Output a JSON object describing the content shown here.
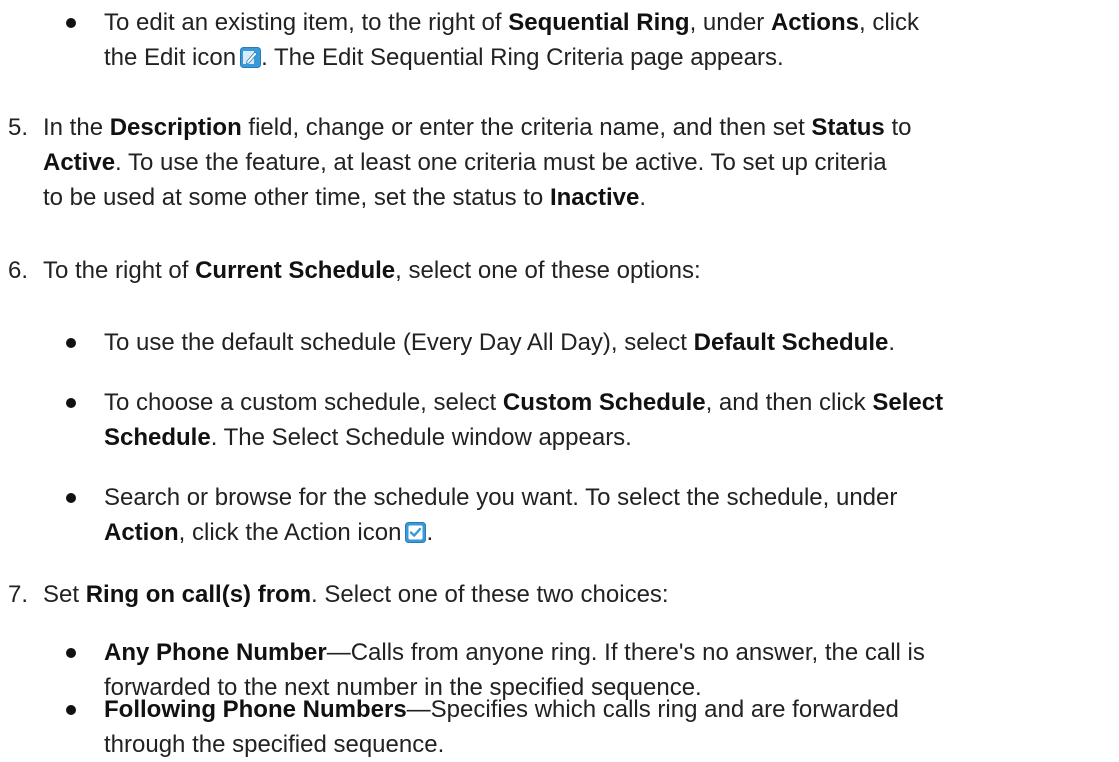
{
  "bullet_edit": {
    "t1": "To edit an existing item, to the right of ",
    "b1": "Sequential Ring",
    "t2": ", under ",
    "b2": "Actions",
    "t3": ", click",
    "t4": "the Edit icon",
    "t5": ". The Edit Sequential Ring Criteria page appears.",
    "icon": "edit-icon"
  },
  "step5": {
    "number": "5.",
    "line1": {
      "t1": "In the ",
      "b1": "Description",
      "t2": " field, change or enter the criteria name, and then set ",
      "b2": "Status",
      "t3": " to"
    },
    "line2": {
      "b1": "Active",
      "t1": ". To use the feature, at least one criteria must be active. To set up criteria"
    },
    "line3": {
      "t1": "to be used at some other time, set the status to ",
      "b1": "Inactive",
      "t2": "."
    }
  },
  "step6": {
    "number": "6.",
    "t1": "To the right of ",
    "b1": "Current Schedule",
    "t2": ", select one of these options:",
    "bullets": [
      {
        "t1": "To use the default schedule (Every Day All Day), select ",
        "b1": "Default Schedule",
        "t2": "."
      },
      {
        "t1": "To choose a custom schedule, select ",
        "b1": "Custom Schedule",
        "t2": ", and then click ",
        "b2": "Select",
        "b3": "Schedule",
        "t3": ". The Select Schedule window appears."
      },
      {
        "t1": "Search or browse for the schedule you want. To select the schedule, under",
        "b1": "Action",
        "t2": ", click the Action icon",
        "t3": ".",
        "icon": "check-icon"
      }
    ]
  },
  "step7": {
    "number": "7.",
    "t1": "Set ",
    "b1": "Ring on call(s) from",
    "t2": ". Select one of these two choices:",
    "bullets": [
      {
        "b1": "Any Phone Number",
        "t1": "—Calls from anyone ring. If there's no answer, the call is",
        "t2": "forwarded to the next number in the specified sequence."
      },
      {
        "b1": "Following Phone Numbers",
        "t1": "—Specifies which calls ring and are forwarded",
        "t2": "through the specified sequence."
      }
    ]
  },
  "colors": {
    "text": "#222222",
    "icon_blue": "#3a9ad9",
    "icon_light": "#d7ecfa"
  }
}
